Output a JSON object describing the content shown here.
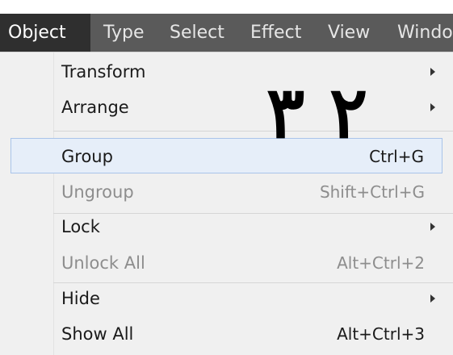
{
  "menubar": {
    "items": [
      {
        "label": "Object",
        "active": true
      },
      {
        "label": "Type"
      },
      {
        "label": "Select"
      },
      {
        "label": "Effect"
      },
      {
        "label": "View"
      },
      {
        "label": "Windo"
      }
    ]
  },
  "dropdown": {
    "items": [
      {
        "label": "Transform",
        "shortcut": "",
        "submenu": true,
        "enabled": true
      },
      {
        "label": "Arrange",
        "shortcut": "",
        "submenu": true,
        "enabled": true
      },
      {
        "label": "Group",
        "shortcut": "Ctrl+G",
        "submenu": false,
        "enabled": true,
        "highlighted": true
      },
      {
        "label": "Ungroup",
        "shortcut": "Shift+Ctrl+G",
        "submenu": false,
        "enabled": false
      },
      {
        "label": "Lock",
        "shortcut": "",
        "submenu": true,
        "enabled": true
      },
      {
        "label": "Unlock All",
        "shortcut": "Alt+Ctrl+2",
        "submenu": false,
        "enabled": false
      },
      {
        "label": "Hide",
        "shortcut": "",
        "submenu": true,
        "enabled": true
      },
      {
        "label": "Show All",
        "shortcut": "Alt+Ctrl+3",
        "submenu": false,
        "enabled": true
      }
    ]
  },
  "annotation": {
    "digit_left": "۳",
    "digit_right": "۲"
  },
  "colors": {
    "menubar_bg": "#5a5a5a",
    "menubar_active_bg": "#2f2f2f",
    "menu_bg": "#f0f0f0",
    "highlight_bg": "#e6eef9",
    "highlight_border": "#a9c4ea",
    "disabled_text": "#8d8d8d"
  }
}
